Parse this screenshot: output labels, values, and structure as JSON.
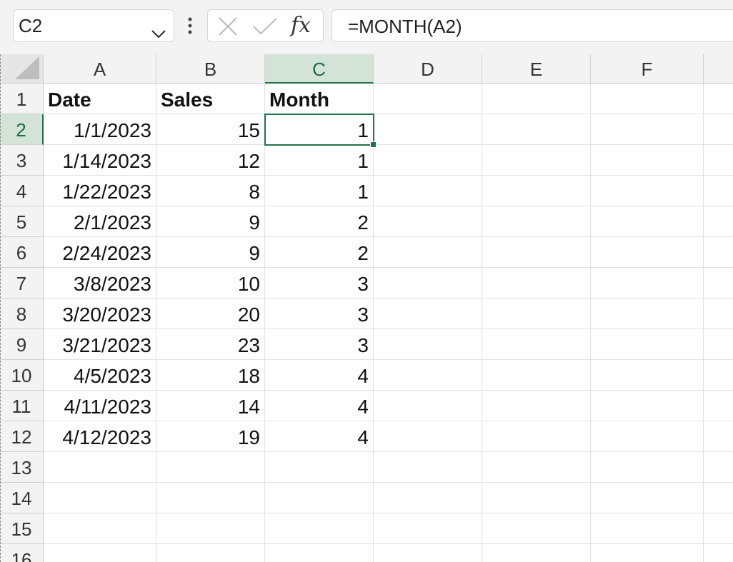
{
  "name_box": {
    "value": "C2"
  },
  "formula_bar": {
    "formula": "=MONTH(A2)",
    "fx_label": "fx"
  },
  "columns": [
    "A",
    "B",
    "C",
    "D",
    "E",
    "F"
  ],
  "rows": [
    "1",
    "2",
    "3",
    "4",
    "5",
    "6",
    "7",
    "8",
    "9",
    "10",
    "11",
    "12",
    "13",
    "14",
    "15",
    "16"
  ],
  "selected": {
    "column": "C",
    "row": "2"
  },
  "colors": {
    "accent": "#217346",
    "selected_header_bg": "#d3e3d7"
  },
  "sheet": {
    "header": [
      "Date",
      "Sales",
      "Month"
    ],
    "data": [
      [
        "1/1/2023",
        "15",
        "1"
      ],
      [
        "1/14/2023",
        "12",
        "1"
      ],
      [
        "1/22/2023",
        "8",
        "1"
      ],
      [
        "2/1/2023",
        "9",
        "2"
      ],
      [
        "2/24/2023",
        "9",
        "2"
      ],
      [
        "3/8/2023",
        "10",
        "3"
      ],
      [
        "3/20/2023",
        "20",
        "3"
      ],
      [
        "3/21/2023",
        "23",
        "3"
      ],
      [
        "4/5/2023",
        "18",
        "4"
      ],
      [
        "4/11/2023",
        "14",
        "4"
      ],
      [
        "4/12/2023",
        "19",
        "4"
      ]
    ]
  }
}
